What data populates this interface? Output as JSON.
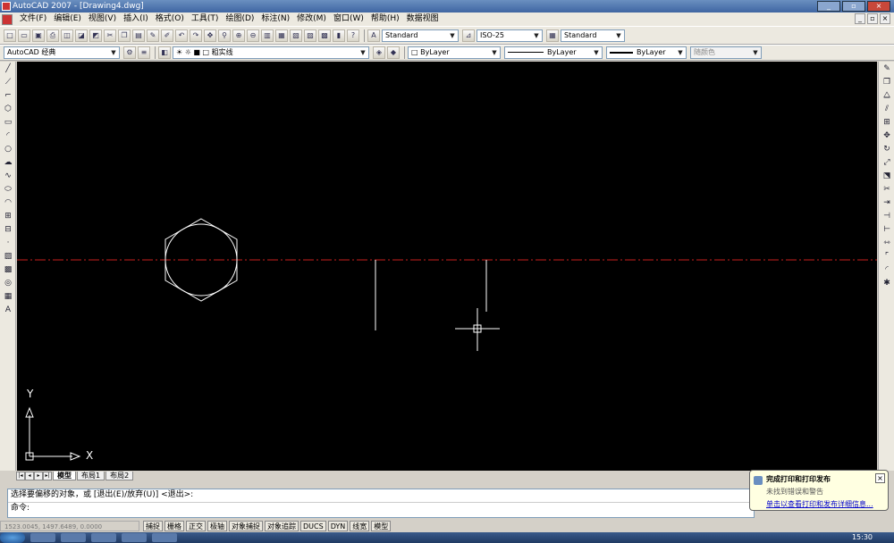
{
  "app": {
    "title": "AutoCAD 2007 - [Drawing4.dwg]"
  },
  "window_buttons": {
    "minimize": "_",
    "restore": "▫",
    "close": "×"
  },
  "menu": [
    "文件(F)",
    "编辑(E)",
    "视图(V)",
    "插入(I)",
    "格式(O)",
    "工具(T)",
    "绘图(D)",
    "标注(N)",
    "修改(M)",
    "窗口(W)",
    "帮助(H)",
    "数据视图"
  ],
  "toolbar1": {
    "text_style": "Standard",
    "dim_style": "ISO-25",
    "table_style": "Standard",
    "icons": [
      "new-icon",
      "open-icon",
      "save-icon",
      "print-icon",
      "preview-icon",
      "publish-icon",
      "3d-dwf-icon",
      "cut-icon",
      "copy-icon",
      "paste-icon",
      "match-properties-icon",
      "block-editor-icon",
      "undo-icon",
      "redo-icon",
      "pan-icon",
      "zoom-realtime-icon",
      "zoom-window-icon",
      "zoom-previous-icon",
      "properties-icon",
      "design-center-icon",
      "tool-palettes-icon",
      "sheet-set-icon",
      "markup-icon",
      "quickcalc-icon",
      "help-icon"
    ]
  },
  "toolbar2": {
    "workspace": "AutoCAD 经典",
    "layer": "粗实线",
    "color": "ByLayer",
    "linetype": "ByLayer",
    "lineweight": "ByLayer",
    "plotstyle": "随颜色"
  },
  "draw_tools": [
    "line-icon",
    "construction-line-icon",
    "polyline-icon",
    "polygon-icon",
    "rectangle-icon",
    "arc-icon",
    "circle-icon",
    "revision-cloud-icon",
    "spline-icon",
    "ellipse-icon",
    "ellipse-arc-icon",
    "insert-block-icon",
    "make-block-icon",
    "point-icon",
    "hatch-icon",
    "gradient-icon",
    "region-icon",
    "table-icon",
    "multiline-text-icon"
  ],
  "modify_tools": [
    "erase-icon",
    "copy-object-icon",
    "mirror-icon",
    "offset-icon",
    "array-icon",
    "move-icon",
    "rotate-icon",
    "scale-icon",
    "stretch-icon",
    "trim-icon",
    "extend-icon",
    "break-at-point-icon",
    "break-icon",
    "join-icon",
    "chamfer-icon",
    "fillet-icon",
    "explode-icon"
  ],
  "ucs": {
    "x_label": "X",
    "y_label": "Y"
  },
  "layout_tabs": [
    "模型",
    "布局1",
    "布局2"
  ],
  "command": {
    "line1": "选择要偏移的对象，或 [退出(E)/放弃(U)] <退出>:",
    "line2": "命令:"
  },
  "status": {
    "coords": "1523.0045, 1497.6489, 0.0000",
    "buttons": [
      "捕捉",
      "栅格",
      "正交",
      "极轴",
      "对象捕捉",
      "对象追踪",
      "DUCS",
      "DYN",
      "线宽",
      "模型"
    ]
  },
  "balloon": {
    "title": "完成打印和打印发布",
    "body": "未找到错误和警告",
    "link": "单击以查看打印和发布详细信息...",
    "close": "×"
  },
  "taskbar": {
    "clock": "15:30"
  },
  "colors": {
    "canvas": "#000000",
    "centerline": "#c8201e",
    "geometry": "#ffffff"
  }
}
